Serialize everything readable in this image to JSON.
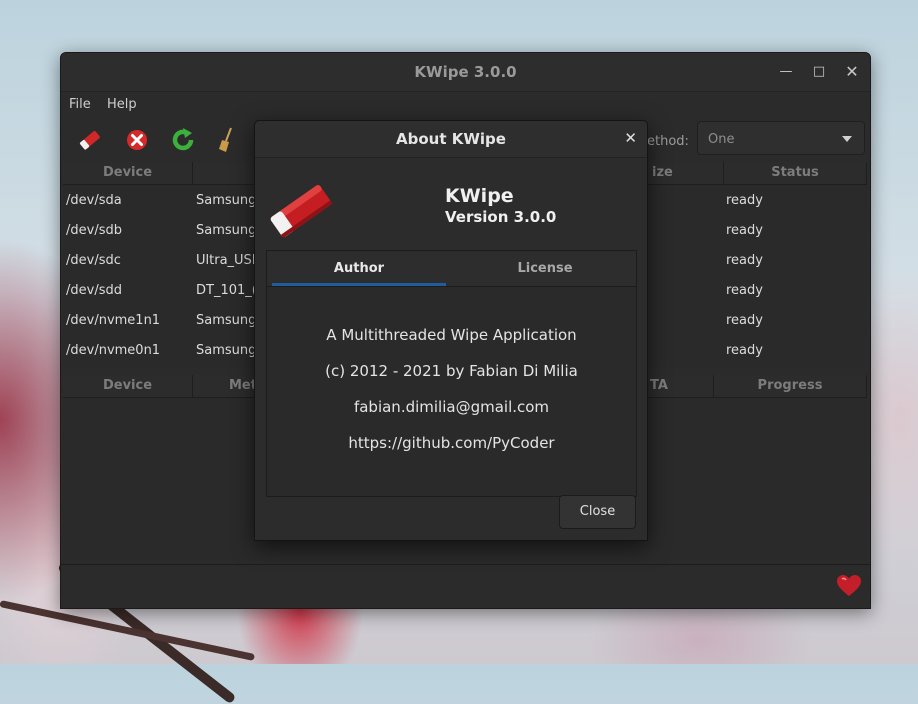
{
  "window": {
    "title": "KWipe 3.0.0"
  },
  "menubar": {
    "file": "File",
    "help": "Help"
  },
  "toolbar": {
    "icons": [
      "eraser-icon",
      "cancel-icon",
      "refresh-icon",
      "broom-icon"
    ],
    "method_label": "ethod:",
    "method_value": "One"
  },
  "devices_table": {
    "headers": [
      "Device",
      "",
      "ize",
      "Status"
    ],
    "rows": [
      {
        "device": "/dev/sda",
        "name": "Samsung",
        "status": "ready"
      },
      {
        "device": "/dev/sdb",
        "name": "Samsung",
        "status": "ready"
      },
      {
        "device": "/dev/sdc",
        "name": "Ultra_USI",
        "status": "ready"
      },
      {
        "device": "/dev/sdd",
        "name": "DT_101_(",
        "status": "ready"
      },
      {
        "device": "/dev/nvme1n1",
        "name": "Samsung",
        "status": "ready"
      },
      {
        "device": "/dev/nvme0n1",
        "name": "Samsung",
        "status": "ready"
      }
    ]
  },
  "jobs_table": {
    "headers": [
      "Device",
      "Met",
      "TA",
      "Progress"
    ]
  },
  "dialog": {
    "title": "About KWipe",
    "app_name": "KWipe",
    "version": "Version 3.0.0",
    "tabs": [
      "Author",
      "License"
    ],
    "author_lines": [
      "A Multithreaded Wipe Application",
      "(c) 2012 - 2021 by Fabian Di Milia",
      "fabian.dimilia@gmail.com",
      "https://github.com/PyCoder"
    ],
    "close_label": "Close"
  },
  "colors": {
    "tab_indicator": "#215d9c",
    "window_bg": "#2b2b2b"
  }
}
